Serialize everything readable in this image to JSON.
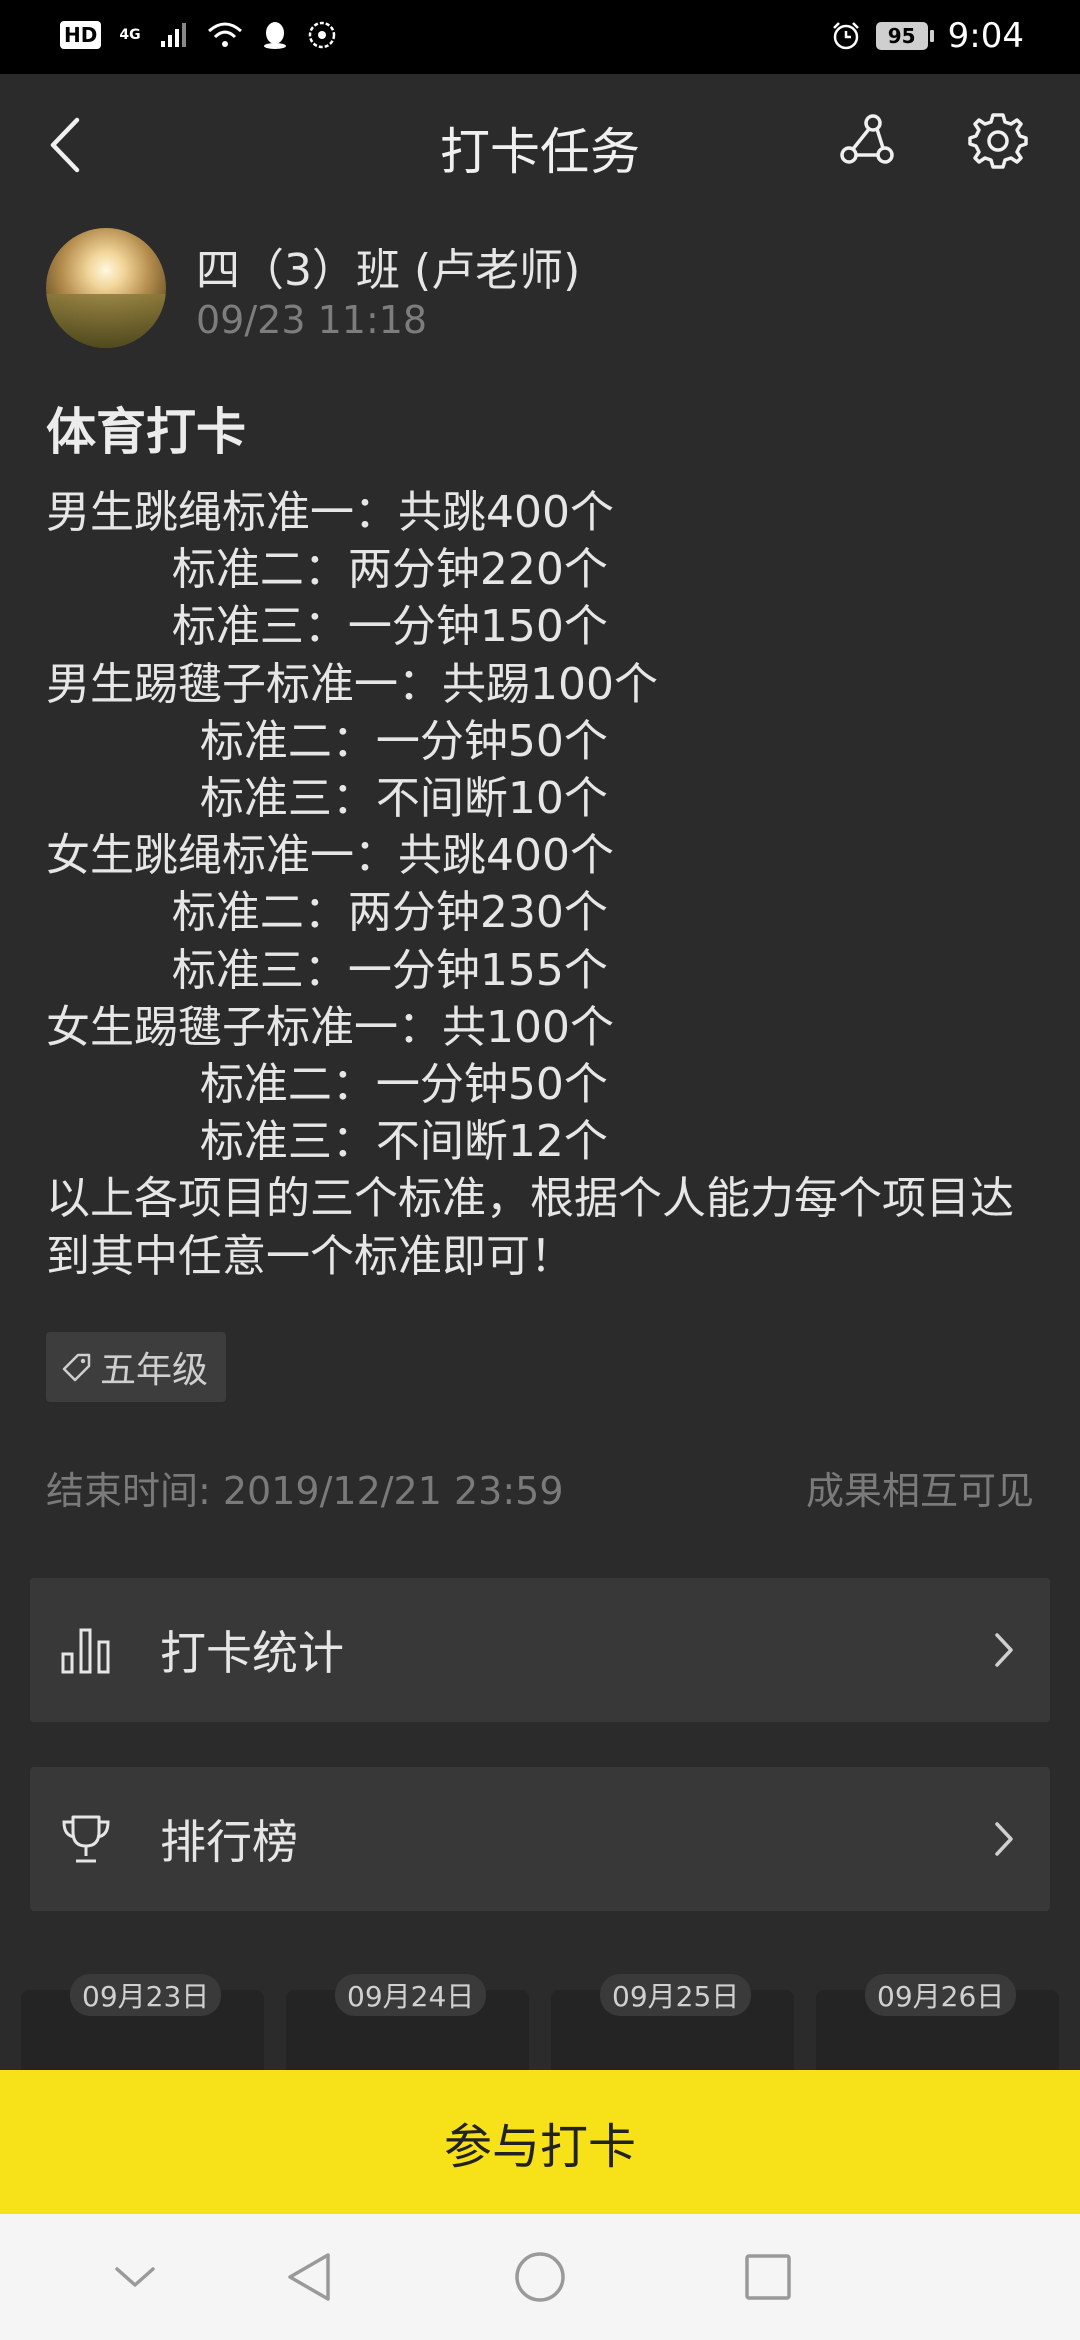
{
  "status_bar": {
    "left_badges": [
      "HD",
      "4G"
    ],
    "battery": "95",
    "time": "9:04"
  },
  "header": {
    "title": "打卡任务"
  },
  "post": {
    "author": "四（3）班 (卢老师)",
    "time": "09/23 11:18",
    "title": "体育打卡",
    "lines": [
      "男生跳绳标准一：共跳400个",
      "         标准二：两分钟220个",
      "         标准三：一分钟150个",
      "男生踢毽子标准一：共踢100个",
      "           标准二：一分钟50个",
      "           标准三：不间断10个",
      "女生跳绳标准一：共跳400个",
      "         标准二：两分钟230个",
      "         标准三：一分钟155个",
      "女生踢毽子标准一：共100个",
      "           标准二：一分钟50个",
      "           标准三：不间断12个"
    ],
    "note": "以上各项目的三个标准，根据个人能力每个项目达到其中任意一个标准即可！",
    "tag": "五年级",
    "end_time": "结束时间: 2019/12/21 23:59",
    "visibility": "成果相互可见"
  },
  "menu": {
    "stats_label": "打卡统计",
    "rank_label": "排行榜"
  },
  "dates": [
    "09月23日",
    "09月24日",
    "09月25日",
    "09月26日"
  ],
  "action": {
    "join_label": "参与打卡"
  },
  "colors": {
    "background": "#2b2b2b",
    "accent_yellow": "#f7e219"
  }
}
